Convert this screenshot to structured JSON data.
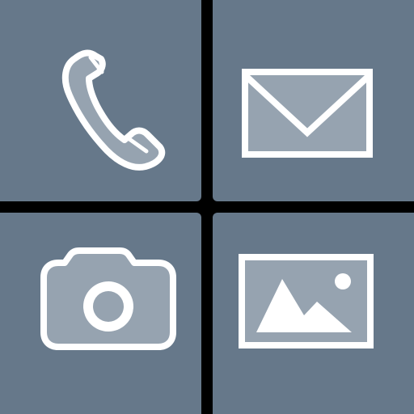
{
  "theme": {
    "tile_color": "#66788a",
    "divider_color": "#000000",
    "icon_stroke": "#ffffff",
    "icon_fill": "#96a3b0"
  },
  "tiles": [
    {
      "name": "phone",
      "icon": "phone-icon"
    },
    {
      "name": "mail",
      "icon": "envelope-icon"
    },
    {
      "name": "camera",
      "icon": "camera-icon"
    },
    {
      "name": "gallery",
      "icon": "image-icon"
    }
  ]
}
